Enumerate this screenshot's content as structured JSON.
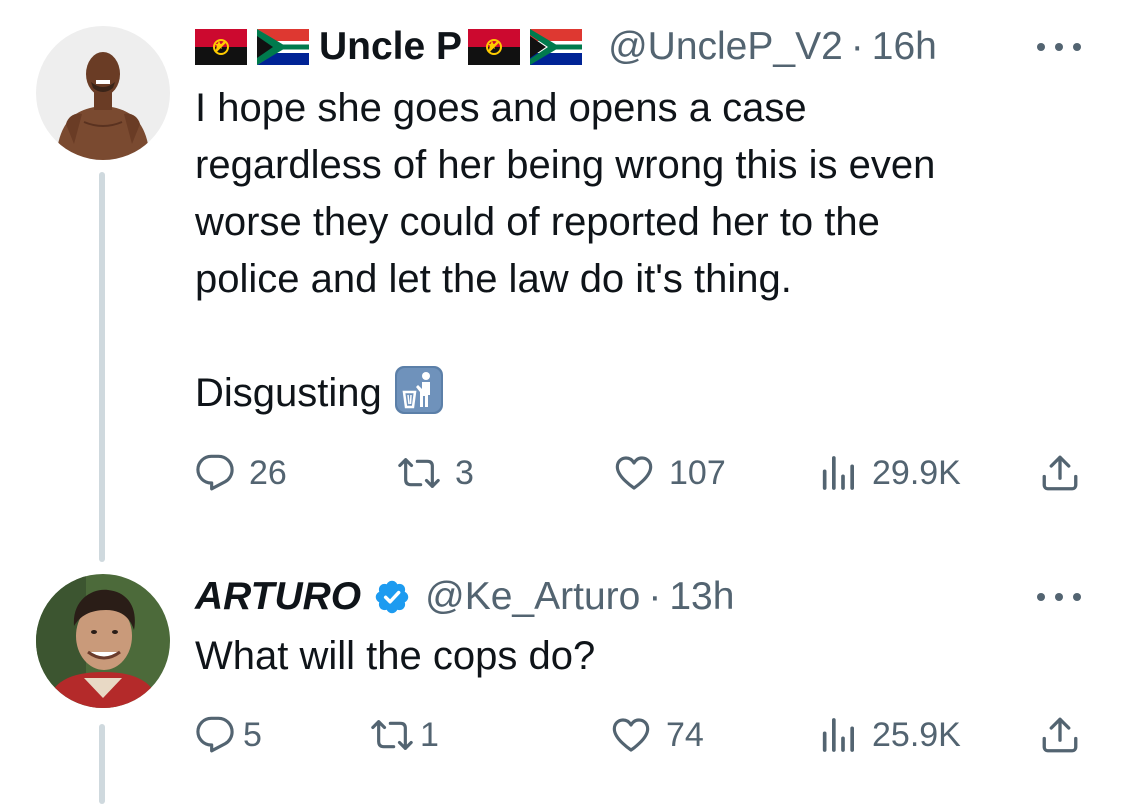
{
  "tweets": [
    {
      "display_name": "Uncle P",
      "name_prefix_flags": [
        "angola-flag-icon",
        "south-africa-flag-icon"
      ],
      "name_suffix_flags": [
        "angola-flag-icon",
        "south-africa-flag-icon"
      ],
      "handle": "@UncleP_V2",
      "separator": "·",
      "time": "16h",
      "text_lines": [
        "I hope she goes and opens a case",
        "regardless of her being wrong this is even",
        "worse they could of reported her to the",
        "police and let the law do it's thing."
      ],
      "text_last_line": "Disgusting",
      "emoji": "put-litter-in-its-place-icon",
      "actions": {
        "replies": "26",
        "retweets": "3",
        "likes": "107",
        "views": "29.9K"
      },
      "verified": false
    },
    {
      "display_name": "ARTURO",
      "handle": "@Ke_Arturo",
      "separator": "·",
      "time": "13h",
      "text": "What will the cops do?",
      "actions": {
        "replies": "5",
        "retweets": "1",
        "likes": "74",
        "views": "25.9K"
      },
      "verified": true
    }
  ],
  "colors": {
    "text": "#0f1419",
    "secondary": "#536471",
    "thread_line": "#cfd9de",
    "verified": "#1d9bf0",
    "angola_red": "#cc092f",
    "sa_green": "#007a4d",
    "sa_blue": "#002395",
    "sa_red": "#de3831",
    "sa_gold": "#ffb612"
  },
  "icons": {
    "reply": "reply-icon",
    "retweet": "retweet-icon",
    "like": "heart-icon",
    "views": "views-bar-chart-icon",
    "share": "share-icon",
    "more": "more-options-icon"
  }
}
